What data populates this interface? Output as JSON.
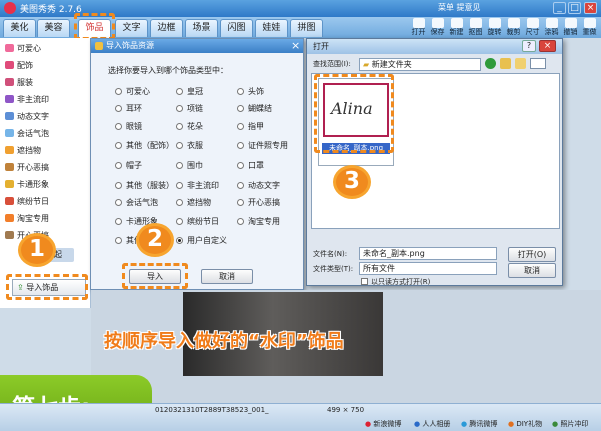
{
  "app": {
    "title": "美图秀秀 2.7.6",
    "top_menu": "菜单  提意见",
    "minimize": "_",
    "maximize": "□",
    "close": "×"
  },
  "tabs": [
    "美化",
    "美容",
    "饰品",
    "文字",
    "边框",
    "场景",
    "闪图",
    "娃娃",
    "拼图"
  ],
  "toolbar": [
    "打开",
    "保存",
    "新建",
    "抠图",
    "旋转",
    "裁剪",
    "尺寸",
    "涂鸦",
    "撤销",
    "重做"
  ],
  "sidebar": {
    "items": [
      "可爱心",
      "配饰",
      "服装",
      "非主流印",
      "动态文字",
      "会话气泡",
      "遮挡物",
      "开心恶搞",
      "卡通形象",
      "缤纷节日",
      "淘宝专用",
      "开心恶搞"
    ],
    "import_label": "导入饰品",
    "fold_label": "收起"
  },
  "dialog1": {
    "title": "导入饰品资源",
    "prompt": "选择你要导入到哪个饰品类型中：",
    "options": [
      [
        "可爱心",
        "皇冠",
        "头饰"
      ],
      [
        "耳环",
        "项链",
        "蝴蝶结"
      ],
      [
        "眼镜",
        "花朵",
        "指甲"
      ],
      [
        "其他（配饰）",
        "衣服",
        "证件照专用"
      ],
      [
        "帽子",
        "围巾",
        "口罩"
      ],
      [
        "其他（服装）",
        "非主流印",
        "动态文字"
      ],
      [
        "会话气泡",
        "遮挡物",
        "开心恶搞"
      ],
      [
        "卡通形象",
        "缤纷节日",
        "淘宝专用"
      ],
      [
        "其他（饰品）",
        "用户自定义"
      ]
    ],
    "selected": "用户自定义",
    "import_btn": "导入",
    "cancel_btn": "取消",
    "close": "×"
  },
  "dialog2": {
    "title": "打开",
    "lookin_label": "查找范围(I):",
    "lookin_value": "新建文件夹",
    "thumb_text": "Alina",
    "file_item": "未命名_副本.png",
    "filename_label": "文件名(N):",
    "filename_value": "未命名_副本.png",
    "filetype_label": "文件类型(T):",
    "filetype_value": "所有文件",
    "readonly_label": "以只读方式打开(R)",
    "open_btn": "打开(O)",
    "cancel_btn": "取消",
    "help": "?",
    "close": "×"
  },
  "annotations": {
    "step1": "1",
    "step2": "2",
    "step3": "3",
    "caption": "按顺序导入做好的“水印”饰品",
    "step_label": "第七步:"
  },
  "statusbar": {
    "filename": "0120321310T2889T38523_001_",
    "size": "499 × 750",
    "links": [
      "新浪微博",
      "人人相册",
      "腾讯微博",
      "DIY礼物",
      "照片冲印"
    ]
  },
  "colors": {
    "accent": "#f08a1e",
    "titlebar": "#2f79c8",
    "step_bg": "#7cb51c"
  }
}
